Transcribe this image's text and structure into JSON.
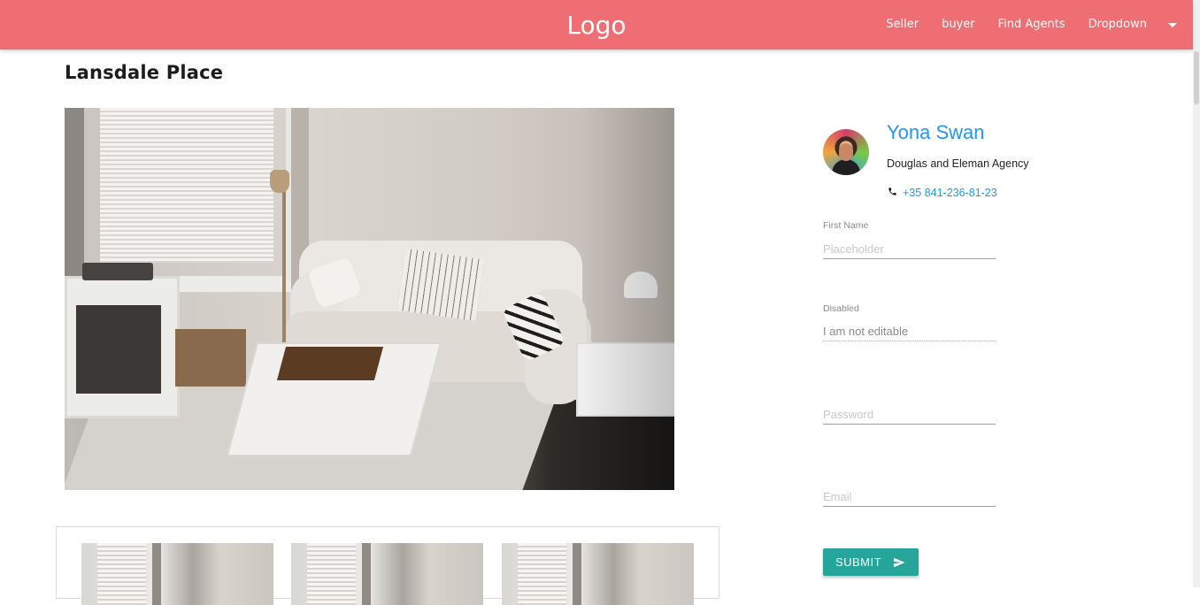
{
  "navbar": {
    "logo": "Logo",
    "links": [
      "Seller",
      "buyer",
      "Find Agents",
      "Dropdown"
    ],
    "brand_color": "#ee6e73"
  },
  "listing": {
    "title": "Lansdale Place"
  },
  "agent": {
    "name": "Yona Swan",
    "agency": "Douglas and Eleman Agency",
    "phone": "+35 841-236-81-23"
  },
  "form": {
    "first_name": {
      "label": "First Name",
      "placeholder": "Placeholder"
    },
    "disabled": {
      "label": "Disabled",
      "value": "I am not editable"
    },
    "password": {
      "placeholder": "Password"
    },
    "email": {
      "placeholder": "Email"
    },
    "submit_label": "SUBMIT",
    "submit_color": "#26a69a"
  },
  "icons": [
    "phone-icon",
    "send-icon",
    "caret-down-icon"
  ]
}
